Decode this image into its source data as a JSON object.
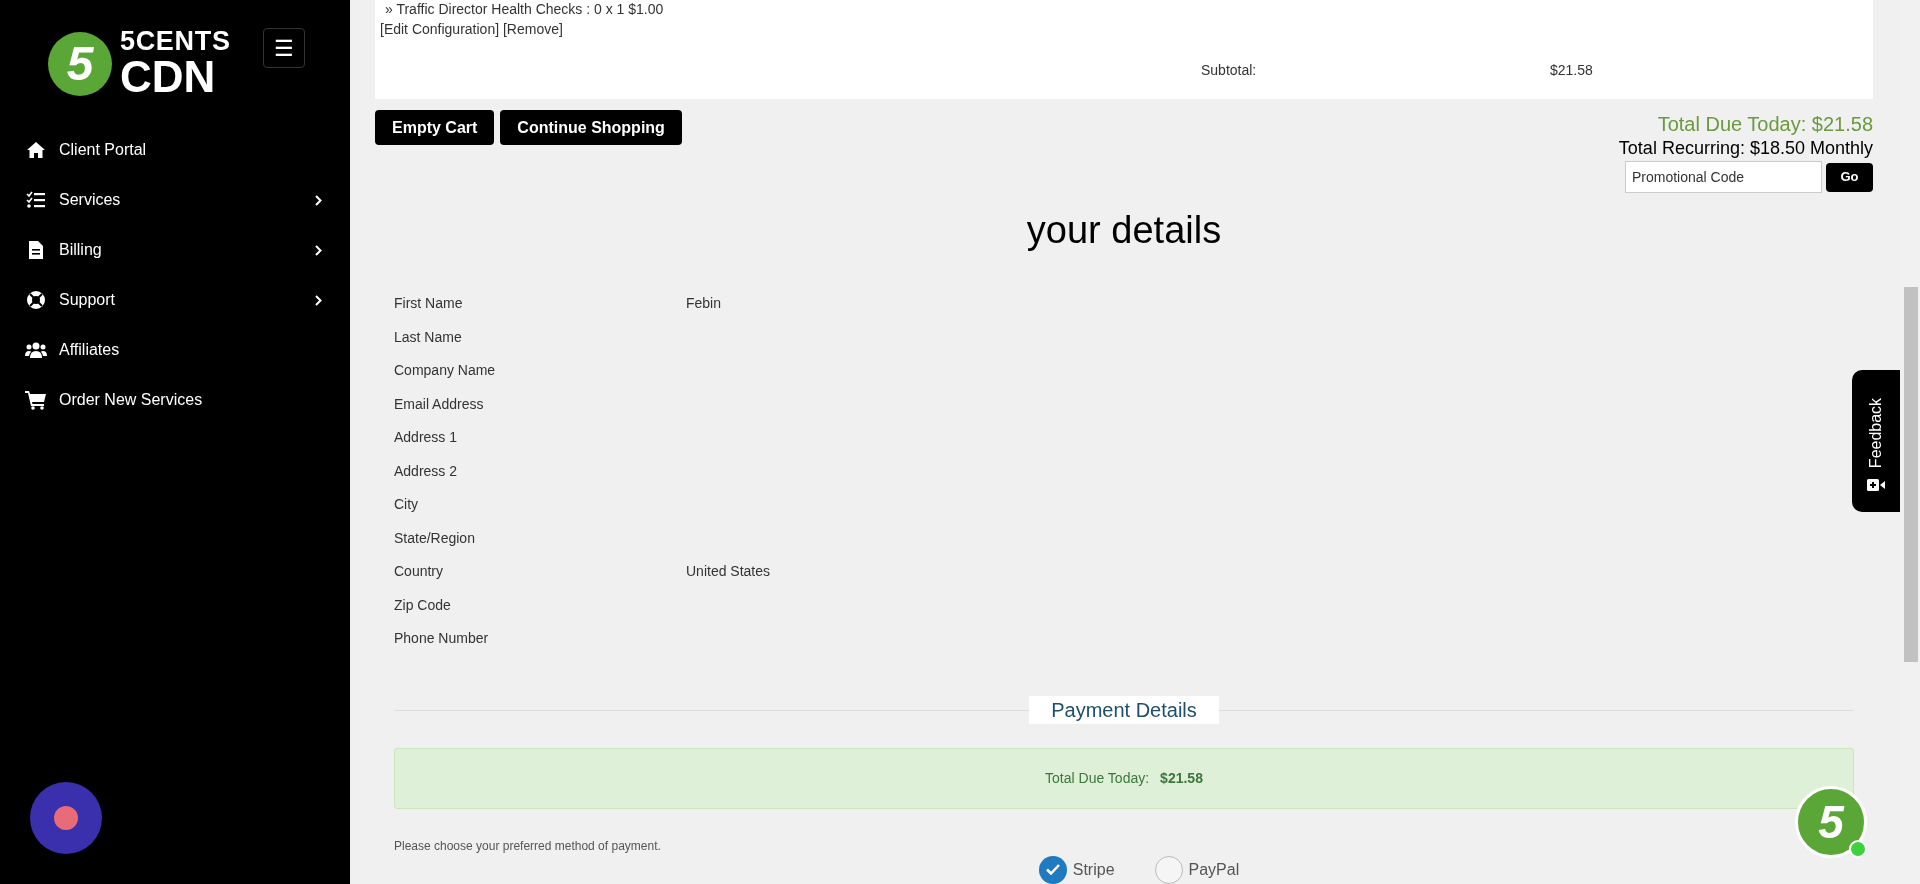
{
  "sidebar": {
    "logo": {
      "badge": "5",
      "line1": "5CENTS",
      "line2": "CDN"
    },
    "menu_button": "☰",
    "items": [
      {
        "label": "Client Portal",
        "expandable": false
      },
      {
        "label": "Services",
        "expandable": true
      },
      {
        "label": "Billing",
        "expandable": true
      },
      {
        "label": "Support",
        "expandable": true
      },
      {
        "label": "Affiliates",
        "expandable": false
      },
      {
        "label": "Order New Services",
        "expandable": false
      }
    ]
  },
  "cart": {
    "item_line": "» Traffic Director Health Checks : 0 x 1 $1.00",
    "actions": "[Edit Configuration] [Remove]",
    "subtotal_label": "Subtotal:",
    "subtotal_value": "$21.58"
  },
  "cart_buttons": [
    "Empty Cart",
    "Continue Shopping"
  ],
  "totals": {
    "due_today": "Total Due Today: $21.58",
    "recurring": "Total Recurring: $18.50 Monthly",
    "promo_placeholder": "Promotional Code",
    "promo_button": "Go"
  },
  "details": {
    "heading": "your details",
    "rows": [
      {
        "label": "First Name",
        "value": "Febin"
      },
      {
        "label": "Last Name"
      },
      {
        "label": "Company Name"
      },
      {
        "label": "Email Address"
      },
      {
        "label": "Address 1"
      },
      {
        "label": "Address 2"
      },
      {
        "label": "City"
      },
      {
        "label": "State/Region"
      },
      {
        "label": "Country",
        "value": "United States"
      },
      {
        "label": "Zip Code"
      },
      {
        "label": "Phone Number"
      }
    ]
  },
  "payment": {
    "heading": "Payment Details",
    "due_label": "Total Due Today:",
    "due_value": "$21.58",
    "prompt": "Please choose your preferred method of payment.",
    "methods": [
      {
        "label": "Stripe",
        "selected": true
      },
      {
        "label": "PayPal",
        "selected": false
      }
    ]
  },
  "feedback_tab": "Feedback",
  "floating_badge": "5"
}
